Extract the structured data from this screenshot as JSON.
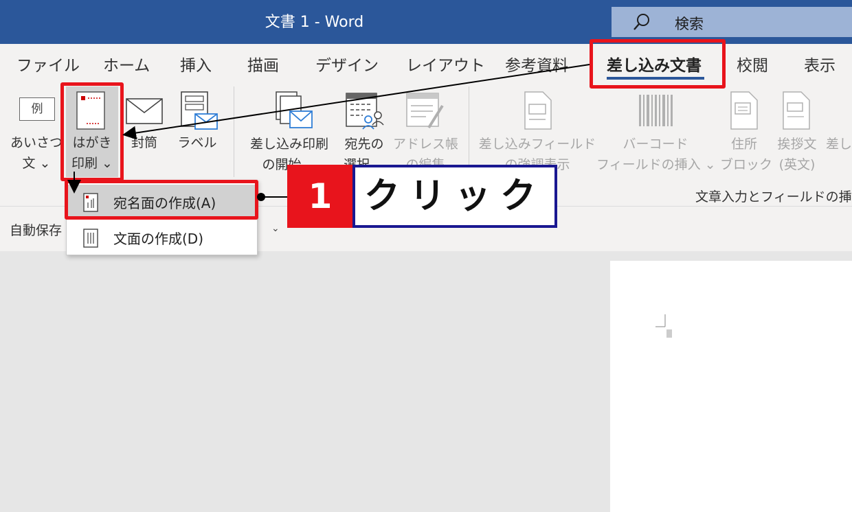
{
  "window": {
    "title": "文書 1  -  Word"
  },
  "search": {
    "label": "検索"
  },
  "tabs": [
    "ファイル",
    "ホーム",
    "挿入",
    "描画",
    "デザイン",
    "レイアウト",
    "参考資料",
    "差し込み文書",
    "校閲",
    "表示"
  ],
  "ribbon": {
    "greeting": {
      "line1": "あいさつ",
      "line2": "文 ⌄",
      "icon_text": "例"
    },
    "postcard": {
      "line1": "はがき",
      "line2": "印刷 ⌄"
    },
    "envelope": {
      "line1": "封筒"
    },
    "label": {
      "line1": "ラベル"
    },
    "start_merge": {
      "line1": "差し込み印刷",
      "line2": "の開始 ⌄"
    },
    "select_recipients": {
      "line1": "宛先の",
      "line2": "選択 ⌄"
    },
    "edit_list": {
      "line1": "アドレス帳",
      "line2": "の編集"
    },
    "highlight_fields": {
      "line1": "差し込みフィールド",
      "line2": "の強調表示"
    },
    "barcode": {
      "line1": "バーコード",
      "line2": "フィールドの挿入 ⌄"
    },
    "address_block": {
      "line1": "住所",
      "line2": "ブロック"
    },
    "greeting_line": {
      "line1": "挨拶文",
      "line2": "(英文)"
    },
    "insert_merge": {
      "line1": "差し"
    },
    "group_label": "文章入力とフィールドの挿"
  },
  "dropdown": {
    "items": [
      {
        "label": "宛名面の作成(A)"
      },
      {
        "label": "文面の作成(D)"
      }
    ]
  },
  "qat": {
    "autosave_label": "自動保存",
    "chevron": "⌄"
  },
  "callout": {
    "number": "1",
    "text": "クリック"
  },
  "colors": {
    "titlebar": "#2b579a",
    "highlight_red": "#e8141c",
    "callout_border": "#1a1891"
  }
}
